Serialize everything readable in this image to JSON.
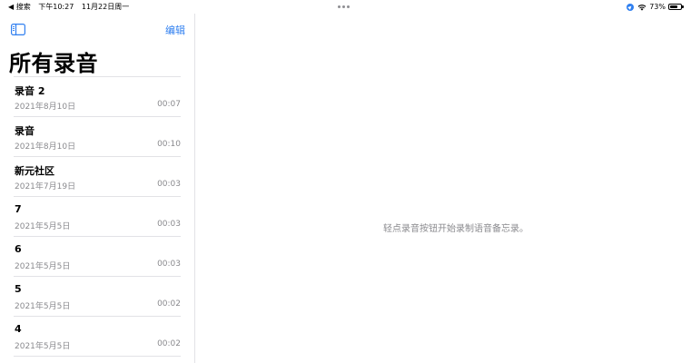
{
  "status_bar": {
    "back_app": "◀ 搜索",
    "time": "下午10:27",
    "date": "11月22日周一",
    "battery_percent": "73%",
    "battery_level": 0.73,
    "icons": [
      "location-icon",
      "wifi-icon",
      "battery-icon"
    ]
  },
  "sidebar": {
    "edit_label": "编辑",
    "title": "所有录音",
    "recordings": [
      {
        "title": "录音 2",
        "date": "2021年8月10日",
        "duration": "00:07"
      },
      {
        "title": "录音",
        "date": "2021年8月10日",
        "duration": "00:10"
      },
      {
        "title": "新元社区",
        "date": "2021年7月19日",
        "duration": "00:03"
      },
      {
        "title": "7",
        "date": "2021年5月5日",
        "duration": "00:03"
      },
      {
        "title": "6",
        "date": "2021年5月5日",
        "duration": "00:03"
      },
      {
        "title": "5",
        "date": "2021年5月5日",
        "duration": "00:02"
      },
      {
        "title": "4",
        "date": "2021年5月5日",
        "duration": "00:02"
      }
    ]
  },
  "main": {
    "empty_hint": "轻点录音按钮开始录制语音备忘录。"
  },
  "colors": {
    "accent": "#2f7ff0",
    "secondary_text": "#8a8a8e",
    "separator": "#e2e2e6"
  }
}
